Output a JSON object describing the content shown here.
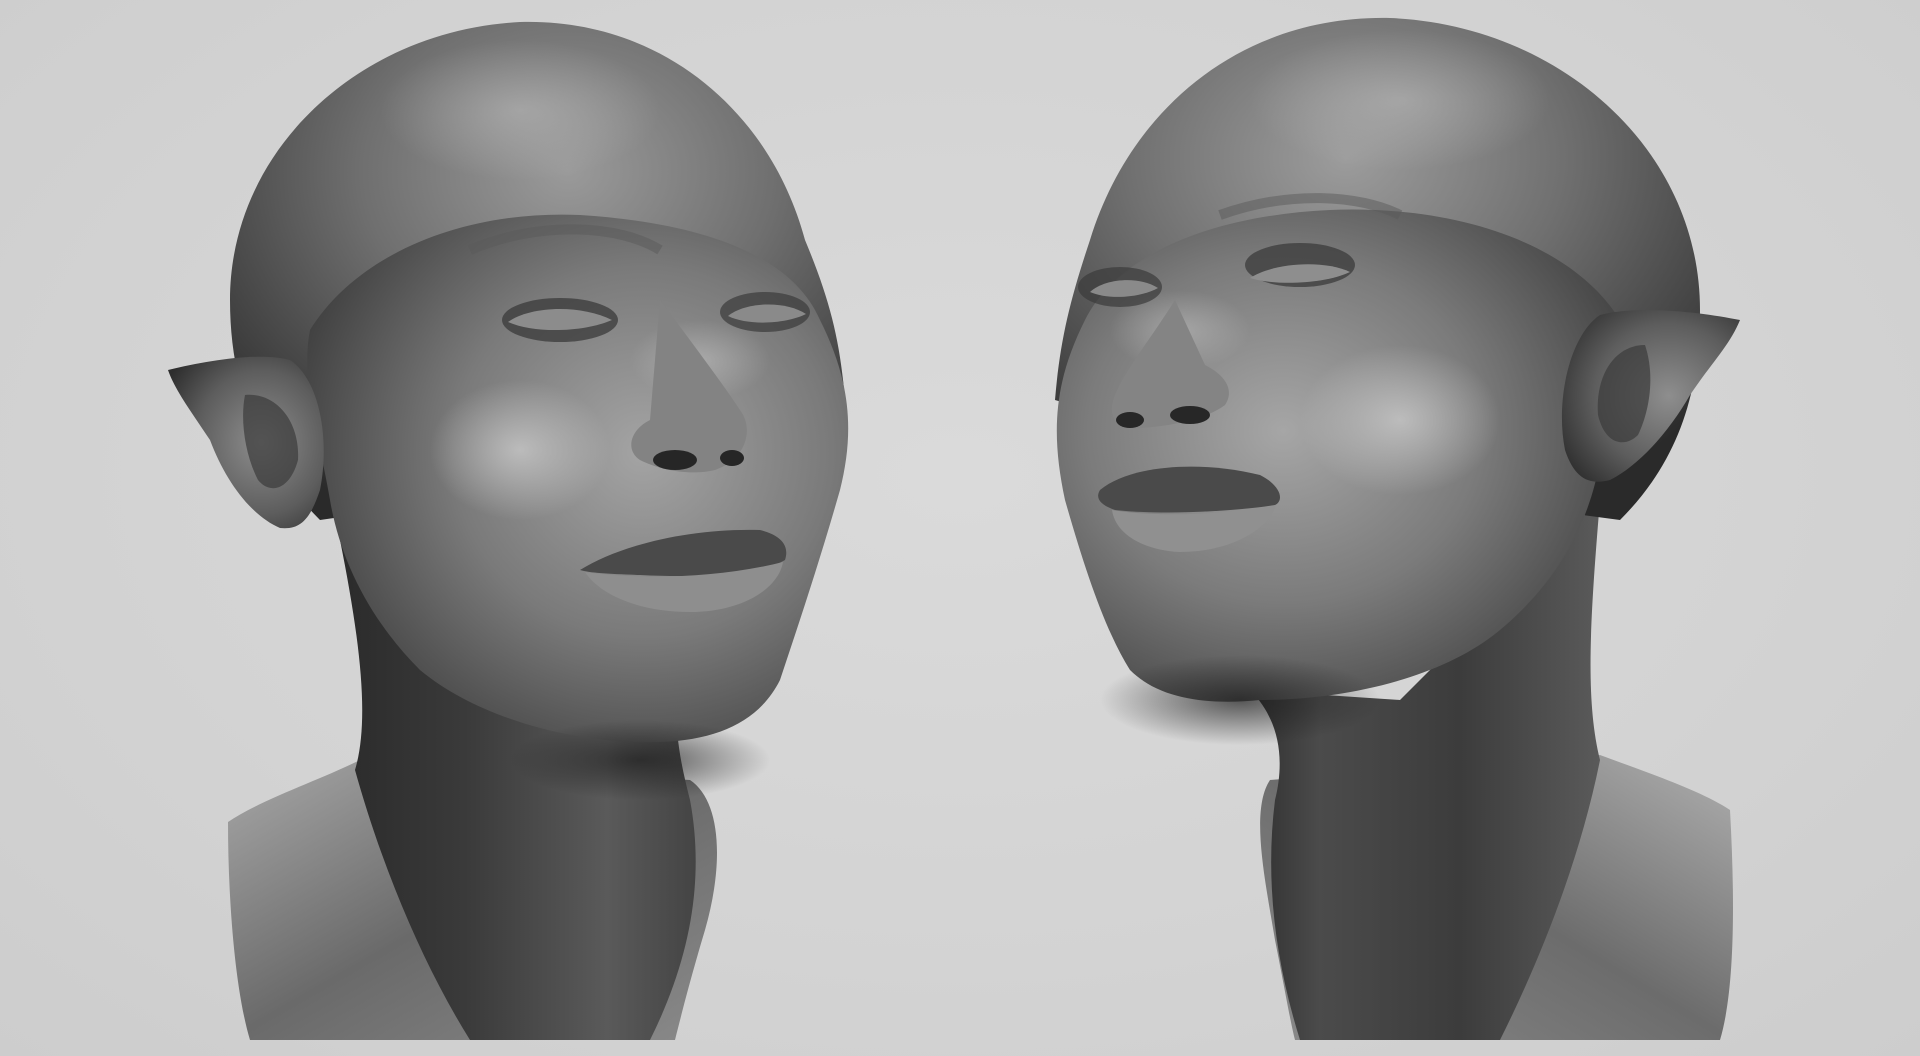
{
  "scene": {
    "background_color": "#d4d4d4",
    "material": "clay-gray",
    "views": [
      {
        "name": "bust-three-quarter-left",
        "facing": "right"
      },
      {
        "name": "bust-three-quarter-right",
        "facing": "left"
      }
    ]
  }
}
